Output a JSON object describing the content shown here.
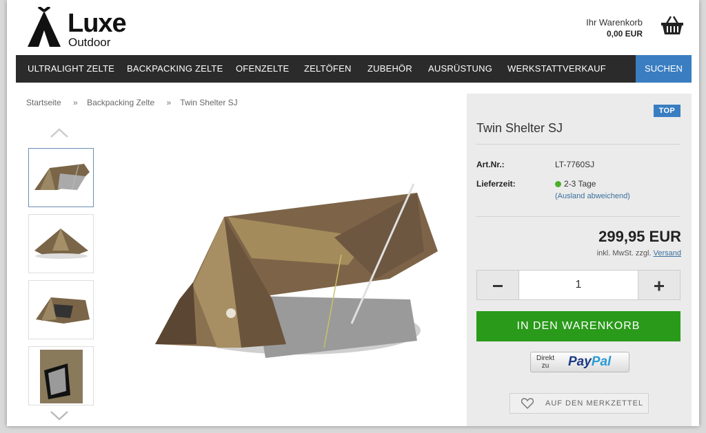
{
  "brand": {
    "name": "Luxe",
    "subtitle": "Outdoor"
  },
  "cart": {
    "label": "Ihr Warenkorb",
    "total": "0,00 EUR",
    "icon": "basket-icon"
  },
  "nav": {
    "items": [
      "ULTRALIGHT ZELTE",
      "BACKPACKING ZELTE",
      "OFENZELTE",
      "ZELTÖFEN",
      "ZUBEHÖR",
      "AUSRÜSTUNG",
      "WERKSTATTVERKAUF"
    ],
    "search_label": "SUCHEN"
  },
  "breadcrumb": {
    "items": [
      "Startseite",
      "Backpacking Zelte",
      "Twin Shelter SJ"
    ],
    "separator": "»"
  },
  "gallery": {
    "thumb_count": 4,
    "active_index": 0,
    "up_icon": "chevron-up-icon",
    "down_icon": "chevron-down-icon"
  },
  "product": {
    "badge": "TOP",
    "title": "Twin Shelter SJ",
    "sku_label": "Art.Nr.:",
    "sku": "LT-7760SJ",
    "delivery_label": "Lieferzeit:",
    "delivery": "2-3 Tage",
    "delivery_note": "(Ausland abweichend)",
    "price": "299,95 EUR",
    "tax_note": "inkl. MwSt. zzgl.",
    "shipping_link": "Versand",
    "quantity": "1",
    "add_to_cart": "IN DEN WARENKORB",
    "paypal_direct": "Direkt",
    "paypal_to": "zu",
    "paypal_pay": "Pay",
    "paypal_pal": "Pal",
    "wishlist": "AUF DEN MERKZETTEL"
  },
  "colors": {
    "nav_bg": "#2b2b2b",
    "accent_blue": "#3a7ec1",
    "cart_green": "#2a9a1a",
    "panel_bg": "#ebebeb"
  }
}
